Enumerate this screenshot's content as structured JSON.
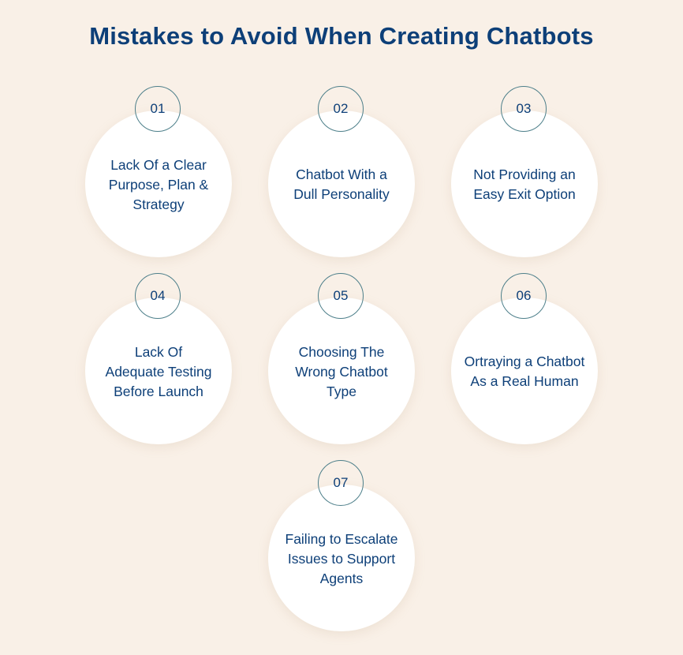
{
  "title": "Mistakes to Avoid When Creating Chatbots",
  "colors": {
    "background": "#f9f0e7",
    "text": "#0d3f78",
    "circle": "#ffffff",
    "number_border": "#4d7f8a"
  },
  "items": [
    {
      "number": "01",
      "text": "Lack Of a Clear Purpose, Plan & Strategy"
    },
    {
      "number": "02",
      "text": "Chatbot With a Dull Personality"
    },
    {
      "number": "03",
      "text": "Not Providing an Easy Exit Option"
    },
    {
      "number": "04",
      "text": "Lack Of Adequate Testing Before Launch"
    },
    {
      "number": "05",
      "text": "Choosing The Wrong Chatbot Type"
    },
    {
      "number": "06",
      "text": "Ortraying a Chatbot As a Real Human"
    },
    {
      "number": "07",
      "text": "Failing to Escalate Issues to Support Agents"
    }
  ]
}
